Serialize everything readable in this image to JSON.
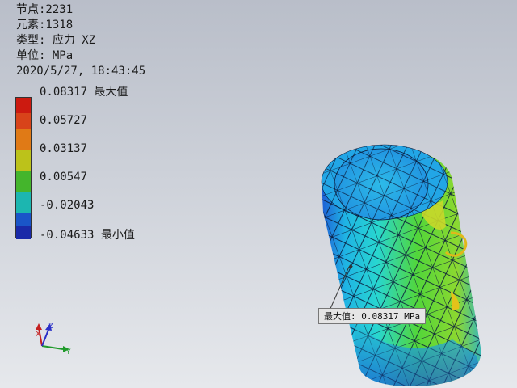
{
  "info": {
    "nodes": "节点:2231",
    "elements": "元素:1318",
    "type": "类型: 应力 XZ",
    "unit": "单位: MPa",
    "timestamp": "2020/5/27, 18:43:45"
  },
  "legend": {
    "labels": [
      {
        "text": "0.08317 最大值"
      },
      {
        "text": "0.05727"
      },
      {
        "text": "0.03137"
      },
      {
        "text": "0.00547"
      },
      {
        "text": "-0.02043"
      },
      {
        "text": "-0.04633 最小值"
      }
    ],
    "colors": [
      "#cc1a10",
      "#e07a16",
      "#bcc21a",
      "#44b52c",
      "#1cb6b0",
      "#1a55c8",
      "#1a2aa8"
    ]
  },
  "tooltip": {
    "text": "最大值: 0.08317 MPa"
  },
  "triad": {
    "x": "X",
    "y": "Y",
    "z": "Z"
  }
}
